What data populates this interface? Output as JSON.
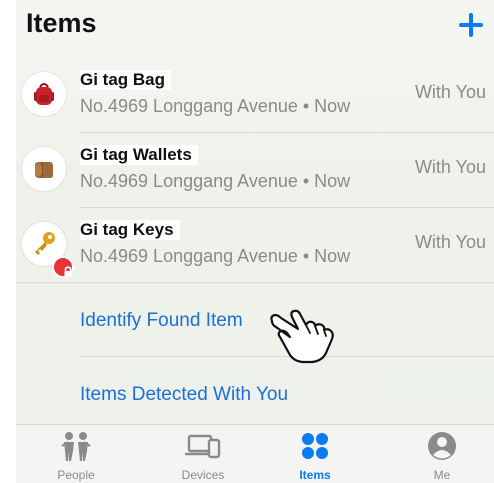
{
  "header": {
    "title": "Items"
  },
  "items": [
    {
      "name": "Gi tag Bag",
      "location": "No.4969 Longgang Avenue • Now",
      "status": "With You"
    },
    {
      "name": "Gi tag Wallets",
      "location": "No.4969 Longgang Avenue • Now",
      "status": "With You"
    },
    {
      "name": "Gi tag Keys",
      "location": "No.4969 Longgang Avenue • Now",
      "status": "With You"
    }
  ],
  "links": {
    "identify": "Identify Found Item",
    "detected": "Items Detected With You"
  },
  "tabs": [
    {
      "label": "People",
      "icon": "people-icon"
    },
    {
      "label": "Devices",
      "icon": "devices-icon"
    },
    {
      "label": "Items",
      "icon": "items-icon"
    },
    {
      "label": "Me",
      "icon": "me-icon"
    }
  ],
  "active_tab": "Items",
  "colors": {
    "accent": "#0a7bf0",
    "link": "#1a6fd8",
    "secondary_text": "#8a8a8a",
    "lock_badge": "#e8333a"
  }
}
